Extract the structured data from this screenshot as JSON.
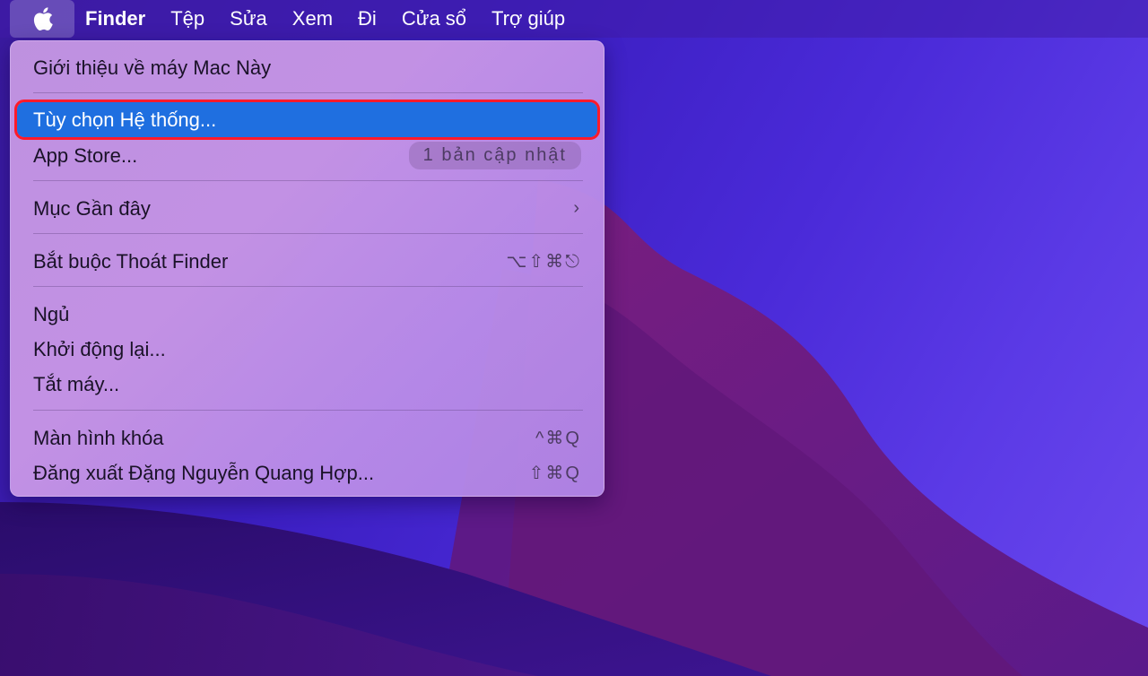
{
  "menubar": {
    "apple_icon": "apple-logo-icon",
    "items": [
      "Finder",
      "Tệp",
      "Sửa",
      "Xem",
      "Đi",
      "Cửa sổ",
      "Trợ giúp"
    ]
  },
  "apple_menu": {
    "about": "Giới thiệu về máy Mac Này",
    "system_prefs": "Tùy chọn Hệ thống...",
    "app_store": "App Store...",
    "app_store_badge": "1 bản cập nhật",
    "recent_items": "Mục Gần đây",
    "force_quit": "Bắt buộc Thoát Finder",
    "force_quit_shortcut": "⌥⇧⌘⎋",
    "sleep": "Ngủ",
    "restart": "Khởi động lại...",
    "shutdown": "Tắt máy...",
    "lock_screen": "Màn hình khóa",
    "lock_screen_shortcut": "^⌘Q",
    "logout": "Đăng xuất Đặng Nguyễn Quang Hợp...",
    "logout_shortcut": "⇧⌘Q"
  },
  "colors": {
    "highlight": "#1f6fe0",
    "annotation_outline": "#ff1a2a"
  }
}
